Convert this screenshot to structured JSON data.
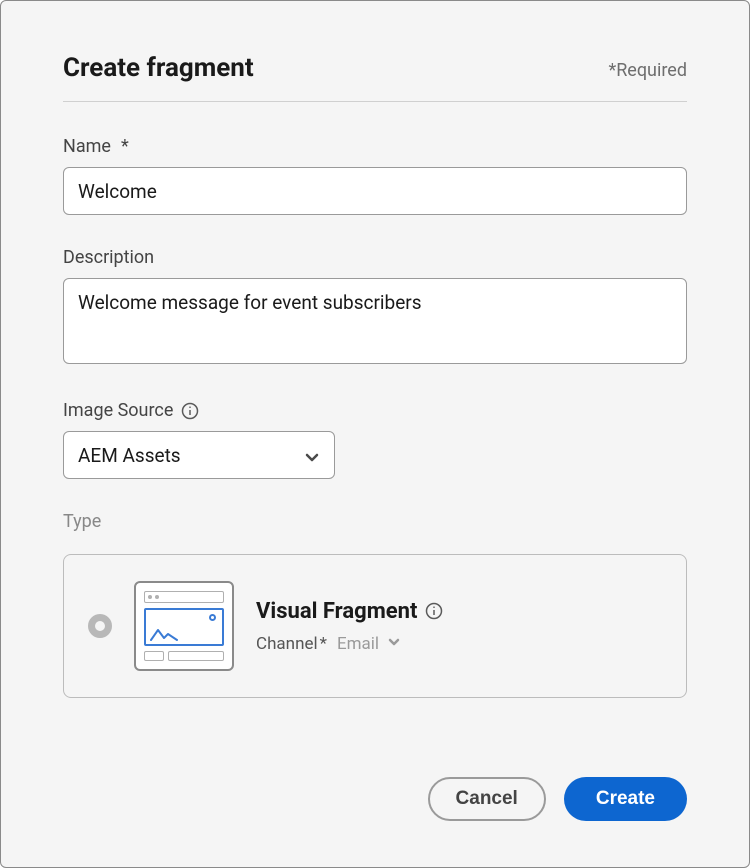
{
  "header": {
    "title": "Create fragment",
    "required_note": "*Required"
  },
  "fields": {
    "name": {
      "label": "Name",
      "required_mark": "*",
      "value": "Welcome"
    },
    "description": {
      "label": "Description",
      "value": "Welcome message for event subscribers"
    },
    "image_source": {
      "label": "Image Source",
      "value": "AEM Assets"
    },
    "type": {
      "label": "Type",
      "option": {
        "title": "Visual Fragment",
        "channel_label": "Channel",
        "channel_required_mark": "*",
        "channel_value": "Email"
      }
    }
  },
  "footer": {
    "cancel": "Cancel",
    "create": "Create"
  }
}
